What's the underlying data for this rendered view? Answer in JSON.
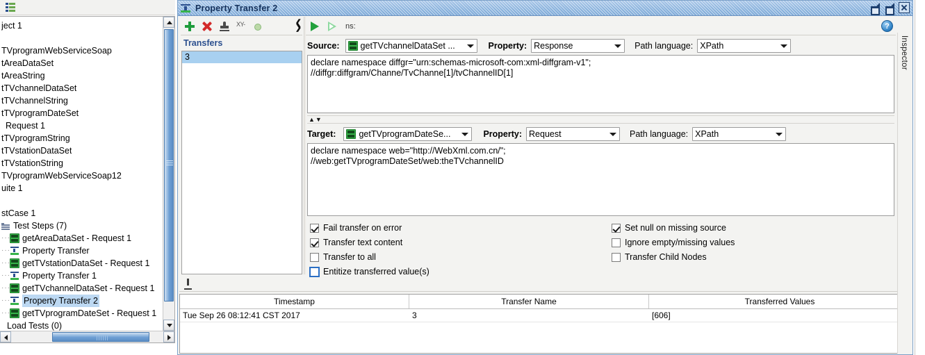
{
  "app": {
    "window_title": "Property Transfer 2",
    "inspector_label": "Inspector"
  },
  "navigator": {
    "toolbar_icon": "list-icon",
    "tree": [
      {
        "label": "ject 1",
        "icon": "none",
        "indent": 0,
        "selected": false
      },
      {
        "label": "",
        "icon": "none",
        "indent": 0,
        "selected": false
      },
      {
        "label": "TVprogramWebServiceSoap",
        "icon": "none",
        "indent": 0,
        "selected": false
      },
      {
        "label": "tAreaDataSet",
        "icon": "none",
        "indent": 0,
        "selected": false
      },
      {
        "label": "tAreaString",
        "icon": "none",
        "indent": 0,
        "selected": false
      },
      {
        "label": "tTVchannelDataSet",
        "icon": "none",
        "indent": 0,
        "selected": false
      },
      {
        "label": "tTVchannelString",
        "icon": "none",
        "indent": 0,
        "selected": false
      },
      {
        "label": "tTVprogramDateSet",
        "icon": "none",
        "indent": 0,
        "selected": false
      },
      {
        "label": "Request 1",
        "icon": "none",
        "indent": 0,
        "selected": false
      },
      {
        "label": "tTVprogramString",
        "icon": "none",
        "indent": 0,
        "selected": false
      },
      {
        "label": "tTVstationDataSet",
        "icon": "none",
        "indent": 0,
        "selected": false
      },
      {
        "label": "tTVstationString",
        "icon": "none",
        "indent": 0,
        "selected": false
      },
      {
        "label": "TVprogramWebServiceSoap12",
        "icon": "none",
        "indent": 0,
        "selected": false
      },
      {
        "label": "uite 1",
        "icon": "none",
        "indent": 0,
        "selected": false
      },
      {
        "label": "",
        "icon": "none",
        "indent": 0,
        "selected": false
      },
      {
        "label": "stCase 1",
        "icon": "none",
        "indent": 0,
        "selected": false
      },
      {
        "label": "Test Steps (7)",
        "icon": "folder-icon",
        "indent": 0,
        "selected": false
      },
      {
        "label": "getAreaDataSet - Request 1",
        "icon": "soap-request-icon",
        "indent": 1,
        "selected": false
      },
      {
        "label": "Property Transfer",
        "icon": "property-transfer-icon",
        "indent": 1,
        "selected": false
      },
      {
        "label": "getTVstationDataSet - Request 1",
        "icon": "soap-request-icon",
        "indent": 1,
        "selected": false
      },
      {
        "label": "Property Transfer 1",
        "icon": "property-transfer-icon",
        "indent": 1,
        "selected": false
      },
      {
        "label": "getTVchannelDataSet - Request 1",
        "icon": "soap-request-icon",
        "indent": 1,
        "selected": false
      },
      {
        "label": "Property Transfer 2",
        "icon": "property-transfer-icon",
        "indent": 1,
        "selected": true
      },
      {
        "label": "getTVprogramDateSet - Request 1",
        "icon": "soap-request-icon",
        "indent": 1,
        "selected": false
      },
      {
        "label": "Load Tests (0)",
        "icon": "none",
        "indent": 0,
        "selected": false
      }
    ]
  },
  "transfers_panel": {
    "header": "Transfers",
    "toolbar": [
      {
        "name": "add-transfer-button",
        "icon": "plus-icon"
      },
      {
        "name": "remove-transfer-button",
        "icon": "x-icon"
      },
      {
        "name": "rename-transfer-button",
        "icon": "stamp-icon"
      },
      {
        "name": "xy-button",
        "icon": "xy-icon",
        "label": "XY-"
      },
      {
        "name": "toggle-button",
        "icon": "dot-icon"
      }
    ],
    "items": [
      {
        "label": "3",
        "selected": true
      }
    ]
  },
  "run_toolbar": {
    "run_button": "run-icon",
    "run_all_button": "run-all-icon",
    "ns_label": "ns:",
    "help_button": "help-icon"
  },
  "source": {
    "label": "Source:",
    "step_value": "getTVchannelDataSet ...",
    "property_label": "Property:",
    "property_value": "Response",
    "path_language_label": "Path language:",
    "path_language_value": "XPath",
    "query": "declare namespace diffgr=\"urn:schemas-microsoft-com:xml-diffgram-v1\";\n//diffgr:diffgram/Channe/TvChanne[1]/tvChannelID[1]"
  },
  "target": {
    "label": "Target:",
    "step_value": "getTVprogramDateSe...",
    "property_label": "Property:",
    "property_value": "Request",
    "path_language_label": "Path language:",
    "path_language_value": "XPath",
    "query": "declare namespace web=\"http://WebXml.com.cn/\";\n//web:getTVprogramDateSet/web:theTVchannelID"
  },
  "options": {
    "left": [
      {
        "label": "Fail transfer on error",
        "checked": true,
        "focused": false
      },
      {
        "label": "Transfer text content",
        "checked": true,
        "focused": false
      },
      {
        "label": "Transfer to all",
        "checked": false,
        "focused": false
      },
      {
        "label": "Entitize transferred value(s)",
        "checked": false,
        "focused": true
      }
    ],
    "right": [
      {
        "label": "Set null on missing source",
        "checked": true,
        "focused": false
      },
      {
        "label": "Ignore empty/missing values",
        "checked": false,
        "focused": false
      },
      {
        "label": "Transfer Child Nodes",
        "checked": false,
        "focused": false
      }
    ]
  },
  "log": {
    "clear_button": "clear-icon",
    "columns": [
      "Timestamp",
      "Transfer Name",
      "Transferred Values"
    ],
    "rows": [
      {
        "timestamp": "Tue Sep 26 08:12:41 CST 2017",
        "transfer_name": "3",
        "transferred_values": "[606]"
      }
    ]
  },
  "colors": {
    "accent_blue": "#2b4f8e",
    "selection_blue": "#a8d0f0",
    "title_blue": "#8cb4de",
    "green": "#37b34a",
    "red": "#d32a2a"
  }
}
